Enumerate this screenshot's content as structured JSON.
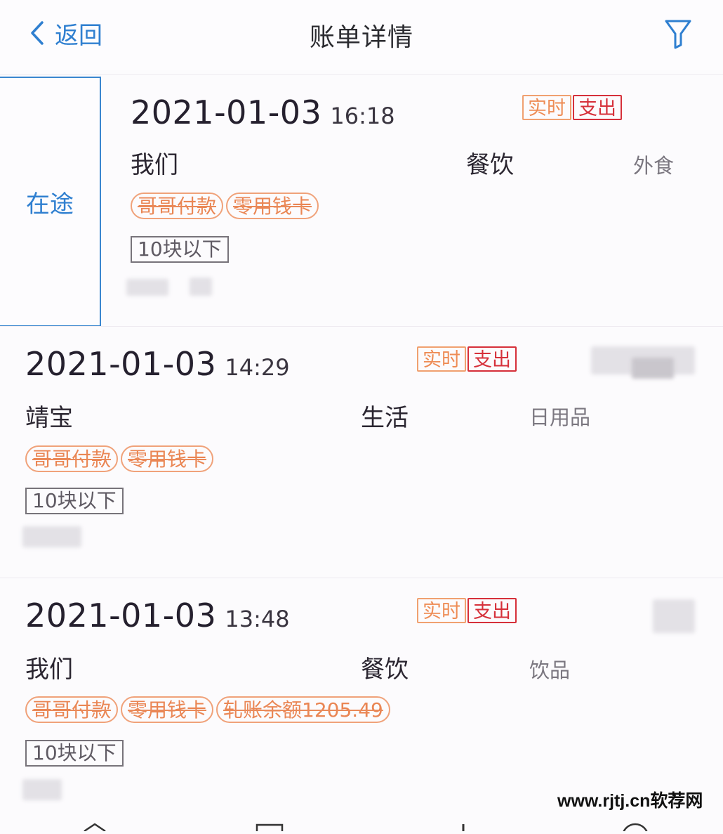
{
  "header": {
    "back_label": "返回",
    "title": "账单详情",
    "back_icon": "chevron-left-icon",
    "filter_icon": "filter-funnel-icon",
    "accent_color": "#2f7fd0"
  },
  "records": [
    {
      "status": "在途",
      "date": "2021-01-03",
      "time": "16:18",
      "badge_realtime": "实时",
      "badge_expense": "支出",
      "member": "我们",
      "category": "餐饮",
      "subcategory": "外食",
      "tags": [
        "哥哥付款",
        "零用钱卡"
      ],
      "amount_tag": "10块以下"
    },
    {
      "date": "2021-01-03",
      "time": "14:29",
      "badge_realtime": "实时",
      "badge_expense": "支出",
      "member": "靖宝",
      "category": "生活",
      "subcategory": "日用品",
      "tags": [
        "哥哥付款",
        "零用钱卡"
      ],
      "amount_tag": "10块以下"
    },
    {
      "date": "2021-01-03",
      "time": "13:48",
      "badge_realtime": "实时",
      "badge_expense": "支出",
      "member": "我们",
      "category": "餐饮",
      "subcategory": "饮品",
      "tags": [
        "哥哥付款",
        "零用钱卡",
        "轧账余额1205.49"
      ],
      "amount_tag": "10块以下"
    }
  ],
  "watermark": "www.rjtj.cn软荐网"
}
